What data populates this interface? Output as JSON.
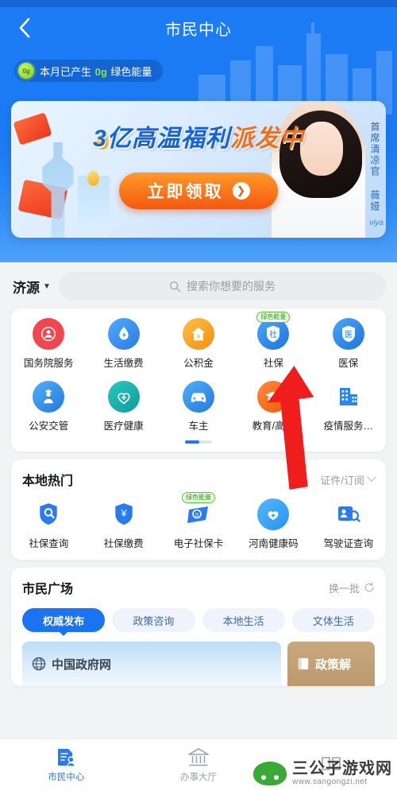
{
  "header": {
    "title": "市民中心",
    "back_icon": "chevron-left-icon",
    "energy": {
      "dot_label": "0g",
      "prefix": "本月已产生 ",
      "amount": "0g",
      "suffix": " 绿色能量"
    }
  },
  "banner": {
    "title_main": "3亿高温福利",
    "title_accent": "派发中",
    "cta_label": "立即领取",
    "cta_arrow": "chevron-right-icon",
    "vertical_text": "首席清凉官 薇娅",
    "vertical_sub": "viya"
  },
  "search": {
    "city": "济源",
    "city_caret": "caret-down-icon",
    "placeholder": "搜索你想要的服务",
    "icon": "search-icon"
  },
  "services": {
    "row1": [
      {
        "label": "国务院服务",
        "icon": "government-emblem-icon",
        "color": "#f0474f",
        "badge": null
      },
      {
        "label": "生活缴费",
        "icon": "water-drop-icon",
        "color": "#3a9bf5",
        "badge": null
      },
      {
        "label": "公积金",
        "icon": "house-yuan-icon",
        "color": "#f5a623",
        "badge": null
      },
      {
        "label": "社保",
        "icon": "shield-she-icon",
        "color": "#2b86e8",
        "badge": "绿色能量"
      },
      {
        "label": "医保",
        "icon": "shield-yi-icon",
        "color": "#2b86e8",
        "badge": null
      }
    ],
    "row2": [
      {
        "label": "公安交管",
        "icon": "police-officer-icon",
        "color": "#3a9bf5",
        "badge": null
      },
      {
        "label": "医疗健康",
        "icon": "stethoscope-heart-icon",
        "color": "#19b3ae",
        "badge": null
      },
      {
        "label": "车主",
        "icon": "car-icon",
        "color": "#3a9bf5",
        "badge": null
      },
      {
        "label": "教育/高考",
        "icon": "graduation-cap-icon",
        "color": "#f5701a",
        "badge": null
      },
      {
        "label": "疫情服务…",
        "icon": "building-icon",
        "color": "#ffffff",
        "badge": null
      }
    ]
  },
  "local_hot": {
    "title": "本地热门",
    "link": "证件/订阅",
    "link_icon": "chevron-right-icon",
    "items": [
      {
        "label": "社保查询",
        "icon": "shield-search-icon",
        "badge": null
      },
      {
        "label": "社保缴费",
        "icon": "shield-yuan-icon",
        "badge": null
      },
      {
        "label": "电子社保卡",
        "icon": "social-security-card-icon",
        "badge": "绿色能量"
      },
      {
        "label": "河南健康码",
        "icon": "health-code-heart-icon",
        "badge": null
      },
      {
        "label": "驾驶证查询",
        "icon": "id-search-icon",
        "badge": null
      }
    ]
  },
  "plaza": {
    "title": "市民广场",
    "refresh_label": "换一批",
    "refresh_icon": "refresh-icon",
    "tabs": [
      {
        "label": "权威发布",
        "active": true
      },
      {
        "label": "政策咨询",
        "active": false
      },
      {
        "label": "本地生活",
        "active": false
      },
      {
        "label": "文体生活",
        "active": false
      }
    ],
    "cards": [
      {
        "label": "中国政府网",
        "icon": "globe-icon"
      },
      {
        "label": "政策解",
        "icon": "book-icon"
      }
    ]
  },
  "tabbar": [
    {
      "label": "市民中心",
      "icon": "citizen-center-icon",
      "active": true
    },
    {
      "label": "办事大厅",
      "icon": "government-hall-icon",
      "active": false
    },
    {
      "label": "",
      "icon": "book-open-icon",
      "active": false
    }
  ],
  "watermark": {
    "name": "三公子游戏网",
    "url": "www.sangongzi.net"
  },
  "colors": {
    "brand_blue": "#1c7cf5",
    "accent_orange": "#f4580f",
    "green": "#59c13f"
  }
}
